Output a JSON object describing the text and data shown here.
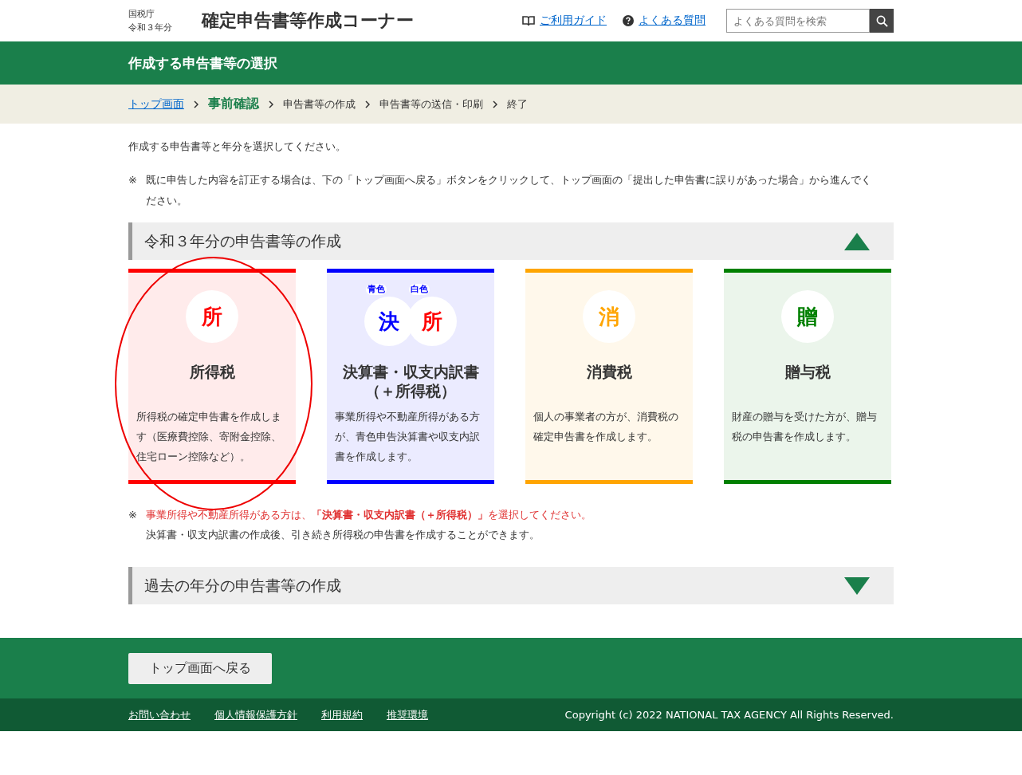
{
  "header": {
    "agency": "国税庁",
    "year": "令和３年分",
    "title": "確定申告書等作成コーナー",
    "links": [
      {
        "label": "ご利用ガイド"
      },
      {
        "label": "よくある質問"
      }
    ],
    "search": {
      "placeholder": "よくある質問を検索"
    }
  },
  "page_title": "作成する申告書等の選択",
  "breadcrumb": [
    {
      "label": "トップ画面",
      "kind": "link"
    },
    {
      "label": "事前確認",
      "kind": "current"
    },
    {
      "label": "申告書等の作成",
      "kind": "step"
    },
    {
      "label": "申告書等の送信・印刷",
      "kind": "step"
    },
    {
      "label": "終了",
      "kind": "step"
    }
  ],
  "intro": "作成する申告書等と年分を選択してください。",
  "note": {
    "mark": "※",
    "text": "既に申告した内容を訂正する場合は、下の「トップ画面へ戻る」ボタンをクリックして、トップ画面の「提出した申告書に誤りがあった場合」から進んでください。"
  },
  "sections": [
    {
      "title": "令和３年分の申告書等の作成",
      "expanded": true,
      "cards": [
        {
          "title": "所得税",
          "color": "#ff0000",
          "icons": [
            {
              "char": "所",
              "color": "#ff0000"
            }
          ],
          "description": "所得税の確定申告書を作成します（医療費控除、寄附金控除、住宅ローン控除など）。"
        },
        {
          "title": "決算書・収支内訳書（＋所得税）",
          "color": "#0000ff",
          "icons": [
            {
              "char": "決",
              "color": "#0000ff",
              "tag": "青色"
            },
            {
              "char": "所",
              "color": "#ff0000",
              "tag": "白色"
            }
          ],
          "description": "事業所得や不動産所得がある方が、青色申告決算書や収支内訳書を作成します。"
        },
        {
          "title": "消費税",
          "color": "#ffa500",
          "icons": [
            {
              "char": "消",
              "color": "#ffa500"
            }
          ],
          "description": "個人の事業者の方が、消費税の確定申告書を作成します。"
        },
        {
          "title": "贈与税",
          "color": "#008000",
          "icons": [
            {
              "char": "贈",
              "color": "#008000"
            }
          ],
          "description": "財産の贈与を受けた方が、贈与税の申告書を作成します。"
        }
      ],
      "notes": [
        {
          "mark": "※",
          "text": "事業所得や不動産所得がある方は、**「決算書・収支内訳書（＋所得税）」**を選択してください。",
          "kind": "warning"
        },
        {
          "text": "決算書・収支内訳書の作成後、引き続き所得税の申告書を作成することができます。",
          "kind": "plain"
        }
      ]
    },
    {
      "title": "過去の年分の申告書等の作成",
      "expanded": false
    }
  ],
  "back_button": "トップ画面へ戻る",
  "footer": {
    "links": [
      "お問い合わせ",
      "個人情報保護方針",
      "利用規約",
      "推奨環境"
    ],
    "copyright": "Copyright (c) 2022 NATIONAL TAX AGENCY All Rights Reserved."
  }
}
